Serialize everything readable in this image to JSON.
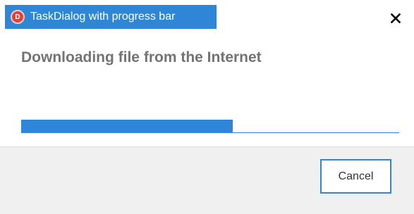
{
  "window": {
    "title": "TaskDialog with progress bar",
    "app_icon": "app-logo-icon",
    "app_icon_glyph": "D",
    "close_icon": "close-icon"
  },
  "content": {
    "main_instruction": "Downloading file from the Internet"
  },
  "progress": {
    "percent": 56,
    "color": "#2f86d6"
  },
  "footer": {
    "cancel_label": "Cancel"
  },
  "colors": {
    "accent": "#2f86d6",
    "instruction_text": "#737373",
    "footer_bg": "#f0f0f0"
  }
}
